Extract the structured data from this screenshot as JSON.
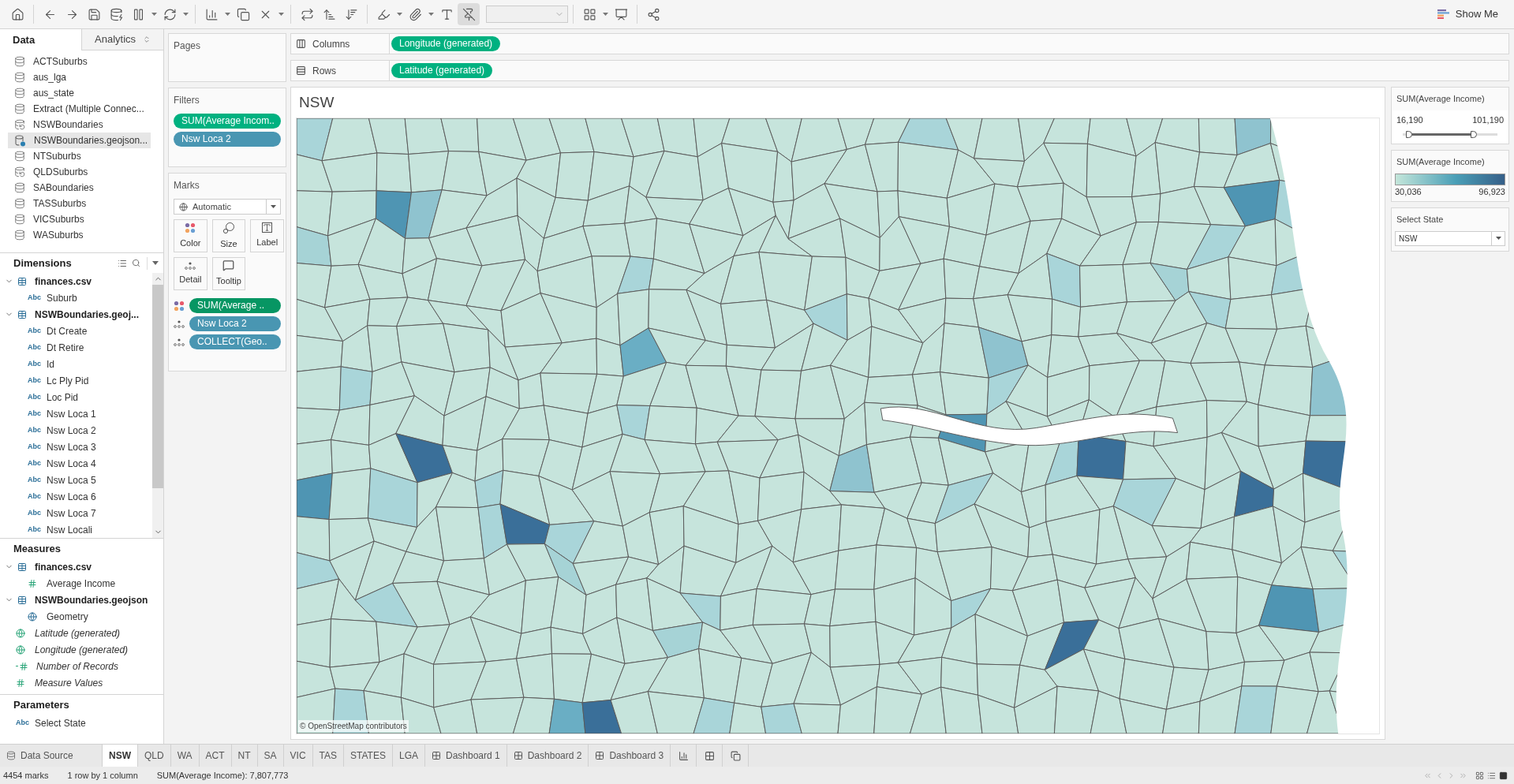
{
  "toolbar": {
    "show_me": "Show Me"
  },
  "side_tabs": [
    {
      "label": "Data",
      "selected": true
    },
    {
      "label": "Analytics",
      "selected": false
    }
  ],
  "data_sources": [
    {
      "name": "ACTSuburbs",
      "kind": "db",
      "selected": false
    },
    {
      "name": "aus_lga",
      "kind": "db",
      "selected": false
    },
    {
      "name": "aus_state",
      "kind": "db",
      "selected": false
    },
    {
      "name": "Extract (Multiple Connec...",
      "kind": "db",
      "selected": false
    },
    {
      "name": "NSWBoundaries",
      "kind": "multi",
      "selected": false
    },
    {
      "name": "NSWBoundaries.geojson...",
      "kind": "primary",
      "selected": true
    },
    {
      "name": "NTSuburbs",
      "kind": "db",
      "selected": false
    },
    {
      "name": "QLDSuburbs",
      "kind": "multi",
      "selected": false
    },
    {
      "name": "SABoundaries",
      "kind": "db",
      "selected": false
    },
    {
      "name": "TASSuburbs",
      "kind": "db",
      "selected": false
    },
    {
      "name": "VICSuburbs",
      "kind": "db",
      "selected": false
    },
    {
      "name": "WASuburbs",
      "kind": "db",
      "selected": false
    }
  ],
  "dimensions": {
    "title": "Dimensions",
    "groups": [
      {
        "name": "finances.csv",
        "expanded": true,
        "children": [
          {
            "name": "Suburb",
            "kind": "text",
            "type_label": "Abc"
          }
        ]
      },
      {
        "name": "NSWBoundaries.geoj...",
        "expanded": true,
        "children": [
          {
            "name": "Dt Create",
            "kind": "text",
            "type_label": "Abc"
          },
          {
            "name": "Dt Retire",
            "kind": "text",
            "type_label": "Abc"
          },
          {
            "name": "Id",
            "kind": "text",
            "type_label": "Abc"
          },
          {
            "name": "Lc Ply Pid",
            "kind": "text",
            "type_label": "Abc"
          },
          {
            "name": "Loc Pid",
            "kind": "text",
            "type_label": "Abc"
          },
          {
            "name": "Nsw Loca 1",
            "kind": "text",
            "type_label": "Abc"
          },
          {
            "name": "Nsw Loca 2",
            "kind": "text",
            "type_label": "Abc"
          },
          {
            "name": "Nsw Loca 3",
            "kind": "text",
            "type_label": "Abc"
          },
          {
            "name": "Nsw Loca 4",
            "kind": "text",
            "type_label": "Abc"
          },
          {
            "name": "Nsw Loca 5",
            "kind": "text",
            "type_label": "Abc"
          },
          {
            "name": "Nsw Loca 6",
            "kind": "text",
            "type_label": "Abc"
          },
          {
            "name": "Nsw Loca 7",
            "kind": "text",
            "type_label": "Abc"
          },
          {
            "name": "Nsw Locali",
            "kind": "text",
            "type_label": "Abc"
          }
        ]
      }
    ]
  },
  "measures": {
    "title": "Measures",
    "groups": [
      {
        "name": "finances.csv",
        "expanded": true,
        "children": [
          {
            "name": "Average Income",
            "kind": "number"
          }
        ]
      },
      {
        "name": "NSWBoundaries.geojson",
        "expanded": true,
        "children": [
          {
            "name": "Geometry",
            "kind": "geo"
          }
        ]
      }
    ],
    "fields": [
      {
        "name": "Latitude (generated)",
        "kind": "geo-generated"
      },
      {
        "name": "Longitude (generated)",
        "kind": "geo-generated"
      },
      {
        "name": "Number of Records",
        "kind": "calc-number"
      },
      {
        "name": "Measure Values",
        "kind": "number-generated"
      }
    ]
  },
  "parameters": {
    "title": "Parameters",
    "items": [
      {
        "name": "Select State",
        "kind": "text",
        "type_label": "Abc"
      }
    ]
  },
  "pages": {
    "title": "Pages"
  },
  "filters": {
    "title": "Filters",
    "pills": [
      {
        "label": "SUM(Average Incom..",
        "kind": "continuous"
      },
      {
        "label": "Nsw Loca 2",
        "kind": "discrete"
      }
    ]
  },
  "marks": {
    "title": "Marks",
    "type": "Automatic",
    "buttons": [
      {
        "label": "Color",
        "kind": "color"
      },
      {
        "label": "Size",
        "kind": "size"
      },
      {
        "label": "Label",
        "kind": "label"
      },
      {
        "label": "Detail",
        "kind": "detail"
      },
      {
        "label": "Tooltip",
        "kind": "tooltip"
      }
    ],
    "encodings": [
      {
        "kind": "color",
        "pill": {
          "label": "SUM(Average ..",
          "kind": "continuous-dark"
        }
      },
      {
        "kind": "detail",
        "pill": {
          "label": "Nsw Loca 2",
          "kind": "discrete"
        }
      },
      {
        "kind": "detail",
        "pill": {
          "label": "COLLECT(Geo..",
          "kind": "discrete"
        }
      }
    ]
  },
  "columns": {
    "label": "Columns",
    "pills": [
      {
        "label": "Longitude (generated)",
        "kind": "continuous"
      }
    ]
  },
  "rows": {
    "label": "Rows",
    "pills": [
      {
        "label": "Latitude (generated)",
        "kind": "continuous"
      }
    ]
  },
  "sheet": {
    "title": "NSW",
    "attribution": "© OpenStreetMap contributors"
  },
  "legends": [
    {
      "kind": "range",
      "title": "SUM(Average Income)",
      "min": "16,190",
      "max": "101,190",
      "thumbs": [
        {
          "level": 0.07
        },
        {
          "level": 0.75
        }
      ]
    },
    {
      "kind": "color",
      "title": "SUM(Average Income)",
      "min": "30,036",
      "max": "96,923"
    },
    {
      "kind": "parameter",
      "title": "Select State",
      "value": "NSW"
    }
  ],
  "sheet_tabs": [
    {
      "label": "Data Source",
      "kind": "source",
      "selected": false
    },
    {
      "label": "NSW",
      "kind": "sheet",
      "selected": true
    },
    {
      "label": "QLD",
      "kind": "sheet",
      "selected": false
    },
    {
      "label": "WA",
      "kind": "sheet",
      "selected": false
    },
    {
      "label": "ACT",
      "kind": "sheet",
      "selected": false
    },
    {
      "label": "NT",
      "kind": "sheet",
      "selected": false
    },
    {
      "label": "SA",
      "kind": "sheet",
      "selected": false
    },
    {
      "label": "VIC",
      "kind": "sheet",
      "selected": false
    },
    {
      "label": "TAS",
      "kind": "sheet",
      "selected": false
    },
    {
      "label": "STATES",
      "kind": "sheet",
      "selected": false
    },
    {
      "label": "LGA",
      "kind": "sheet",
      "selected": false
    },
    {
      "label": "Dashboard 1",
      "kind": "dashboard",
      "selected": false
    },
    {
      "label": "Dashboard 2",
      "kind": "dashboard",
      "selected": false
    },
    {
      "label": "Dashboard 3",
      "kind": "dashboard",
      "selected": false
    }
  ],
  "status_bar": [
    "4454 marks",
    "1 row by 1 column",
    "SUM(Average Income): 7,807,773"
  ]
}
